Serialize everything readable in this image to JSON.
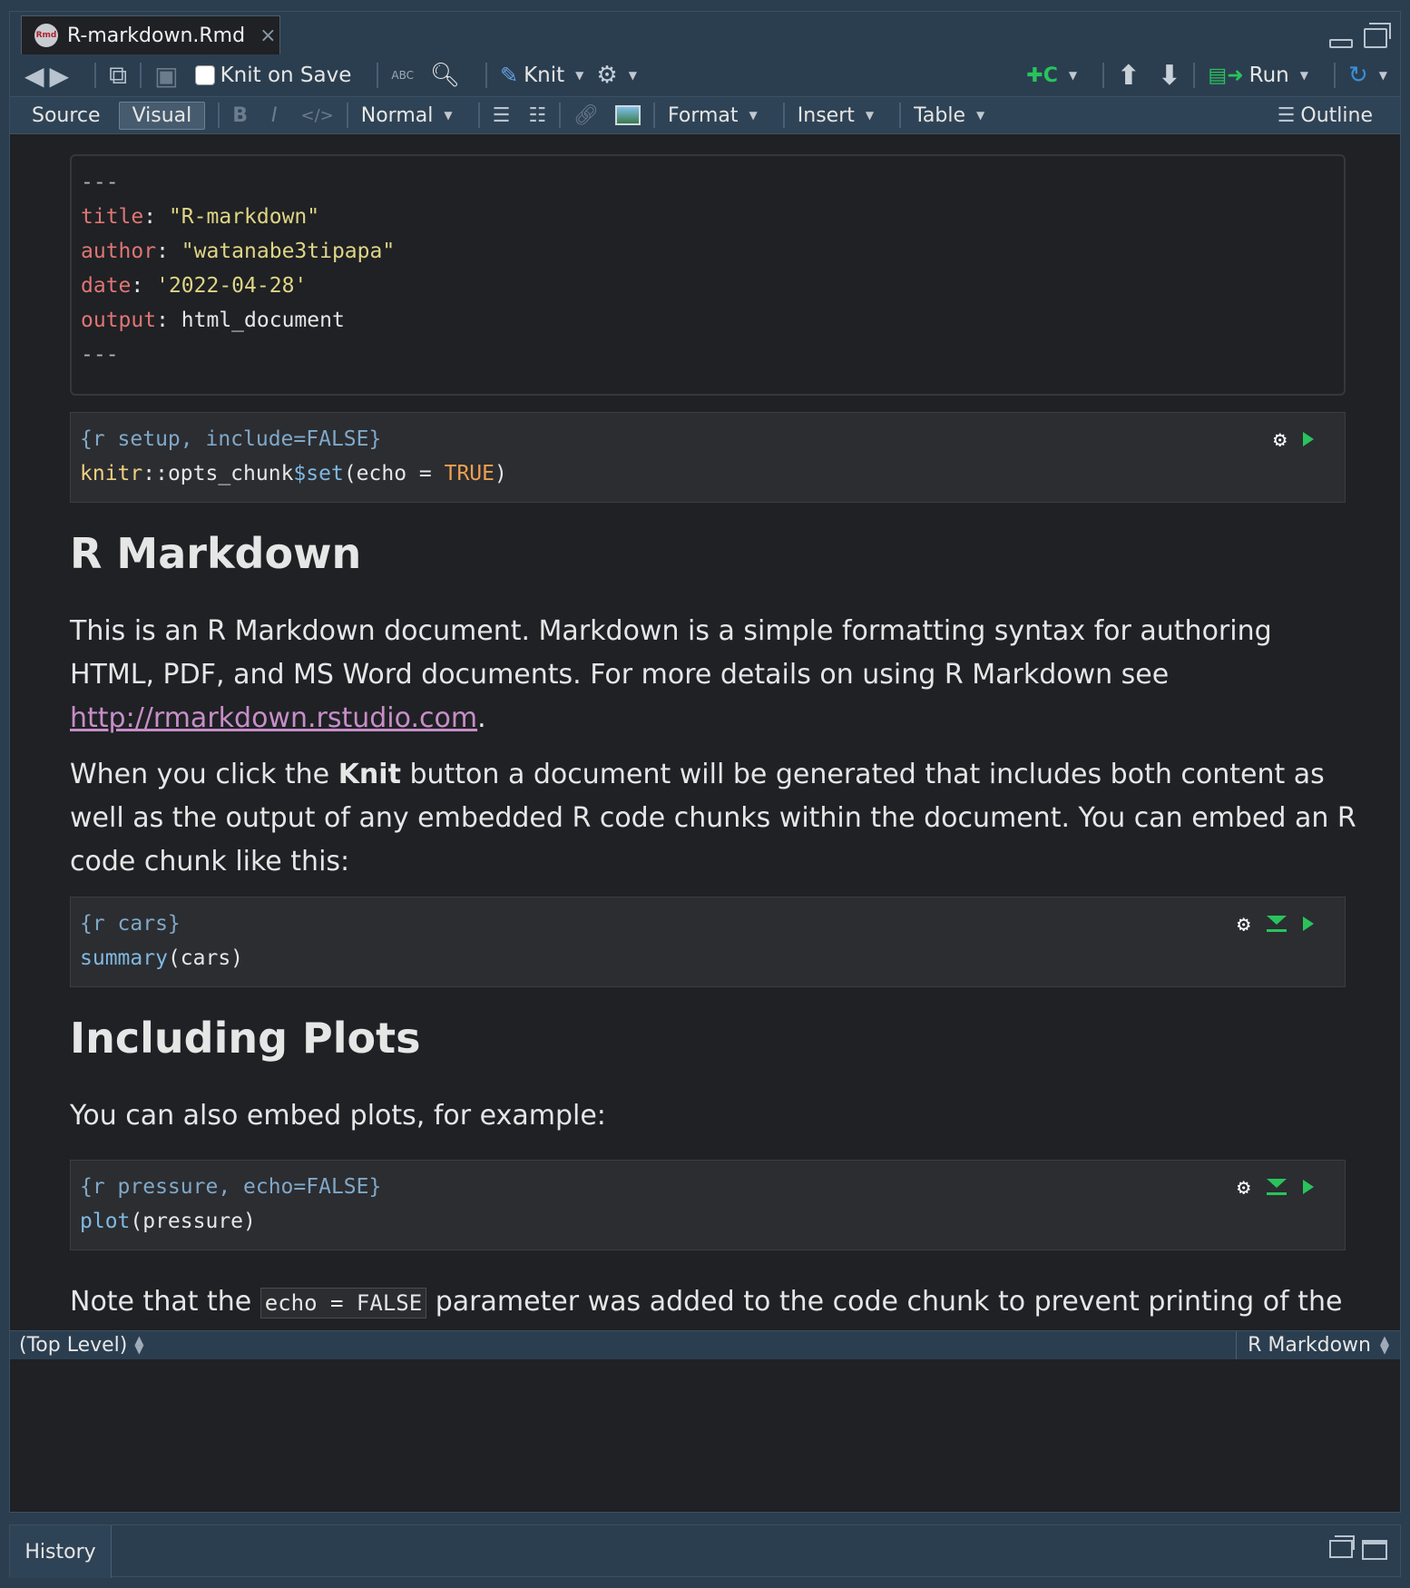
{
  "tab": {
    "filename": "R-markdown.Rmd",
    "close": "×",
    "icon_label": "Rmd"
  },
  "toolbar": {
    "knit_on_save": "Knit on Save",
    "spell_label": "ABC",
    "knit": "Knit",
    "insert_chunk": "C",
    "run": "Run"
  },
  "editor_toolbar": {
    "source": "Source",
    "visual": "Visual",
    "bold": "B",
    "italic": "I",
    "code": "</>",
    "style": "Normal",
    "format": "Format",
    "insert": "Insert",
    "table": "Table",
    "outline": "Outline"
  },
  "yaml": {
    "dashes": "---",
    "title_key": "title",
    "title_val": "\"R-markdown\"",
    "author_key": "author",
    "author_val": "\"watanabe3tipapa\"",
    "date_key": "date",
    "date_val": "'2022-04-28'",
    "output_key": "output",
    "output_val": "html_document"
  },
  "chunks": [
    {
      "header": "{r setup, include=FALSE}",
      "code_a": "knitr",
      "code_b": "::opts_chunk",
      "code_c": "$set",
      "code_d": "(echo = ",
      "code_e": "TRUE",
      "code_f": ")"
    },
    {
      "header": "{r cars}",
      "fn": "summary",
      "args": "(cars)"
    },
    {
      "header": "{r pressure, echo=FALSE}",
      "fn": "plot",
      "args": "(pressure)"
    }
  ],
  "content": {
    "h1": "R Markdown",
    "p1": "This is an R Markdown document. Markdown is a simple formatting syntax for authoring HTML, PDF, and MS Word documents. For more details on using R Markdown see ",
    "p1_link": "http://rmarkdown.rstudio.com",
    "p1_end": ".",
    "p2_a": "When you click the ",
    "p2_bold": "Knit",
    "p2_b": " button a document will be generated that includes both content as well as the output of any embedded R code chunks within the document. You can embed an R code chunk like this:",
    "h2": "Including Plots",
    "p3": "You can also embed plots, for example:",
    "p4_a": "Note that the ",
    "p4_code": "echo = FALSE",
    "p4_b": " parameter was added to the code chunk to prevent printing of the R code that generated the plot."
  },
  "status": {
    "left": "(Top Level)",
    "right": "R Markdown"
  },
  "lower_pane": {
    "tab": "History"
  },
  "colors": {
    "accent_green": "#29c35b",
    "link": "#c78ec8",
    "yaml_key": "#e07575",
    "yaml_string": "#e0d585"
  }
}
